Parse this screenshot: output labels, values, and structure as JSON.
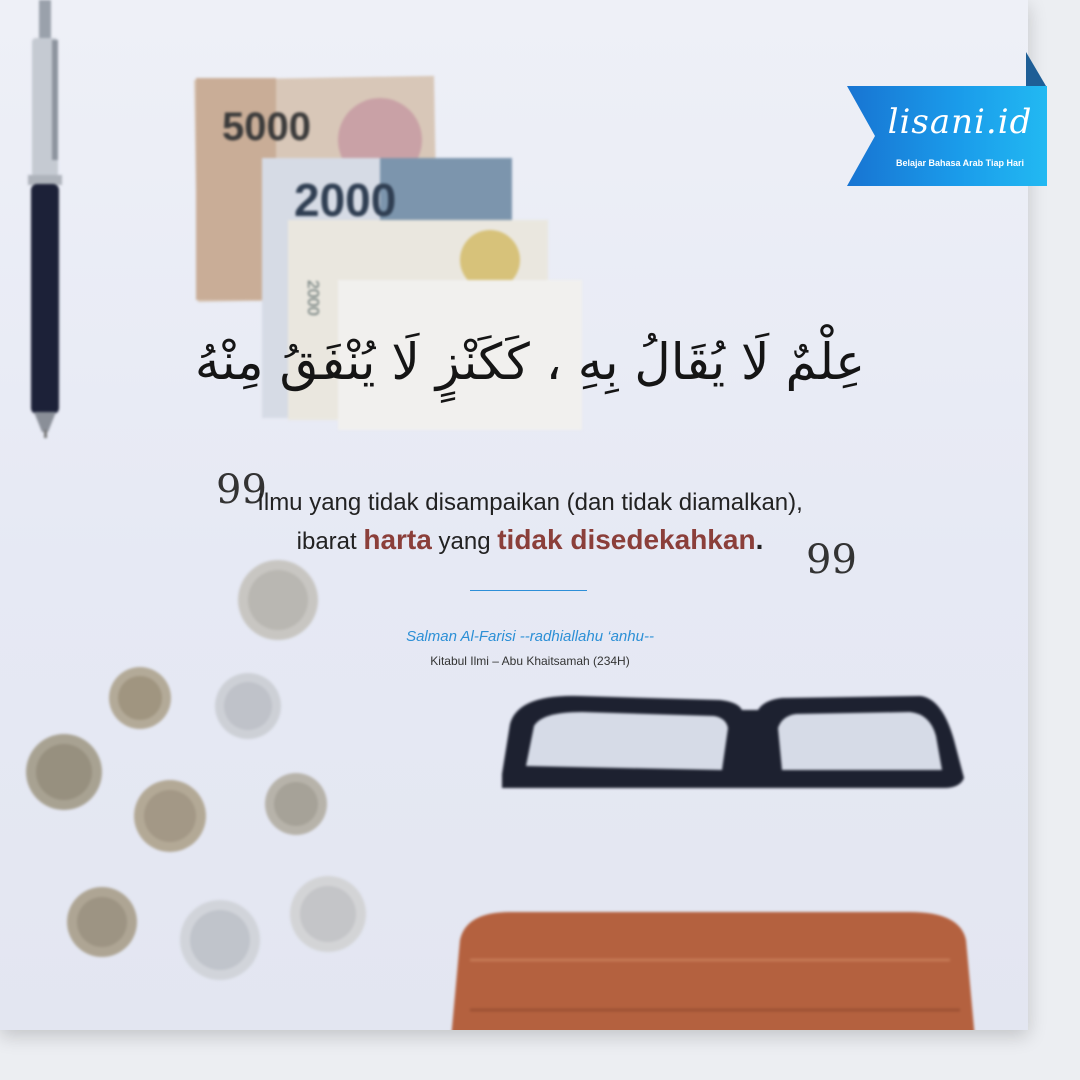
{
  "brand": {
    "logo_text": "lisani.id",
    "tagline": "Belajar Bahasa Arab Tiap Hari"
  },
  "arabic_text": "عِلْمٌ لَا يُقَالُ بِهِ ، كَكَنْزٍ لَا يُنْفَقُ مِنْهُ",
  "translation": {
    "line1": "Ilmu yang tidak disampaikan (dan tidak diamalkan),",
    "line2_prefix": "ibarat",
    "line2_highlight1": "harta",
    "line2_middle": "yang",
    "line2_highlight2": "tidak disedekahkan",
    "line2_end": "."
  },
  "quote_marks": {
    "open": "99",
    "close": "99"
  },
  "attribution": {
    "author": "Salman Al-Farisi --radhiallahu ‘anhu--",
    "source": "Kitabul Ilmi – Abu Khaitsamah (234H)"
  },
  "banknotes": [
    "5000",
    "2000",
    "2000"
  ],
  "colors": {
    "highlight": "#8b3f3a",
    "accent_blue": "#2c8fd6",
    "badge_blue": "#1a9bea"
  },
  "icons": [
    "pen-icon",
    "banknotes-image",
    "coins-image",
    "glasses-image",
    "wallet-image"
  ]
}
